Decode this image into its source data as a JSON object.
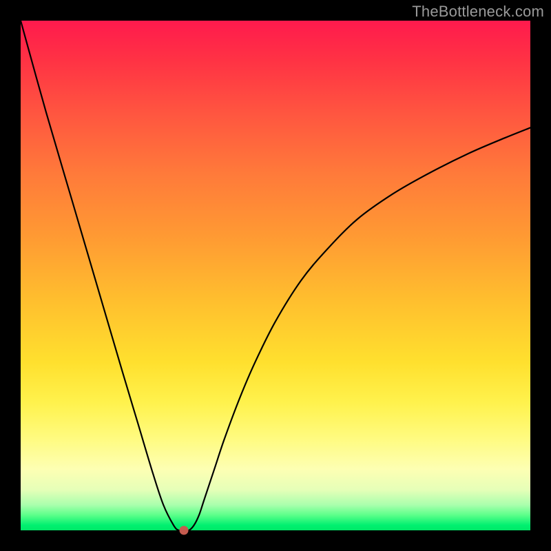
{
  "watermark": "TheBottleneck.com",
  "chart_data": {
    "type": "line",
    "title": "",
    "xlabel": "",
    "ylabel": "",
    "xlim": [
      0,
      100
    ],
    "ylim": [
      0,
      100
    ],
    "grid": false,
    "series": [
      {
        "name": "curve",
        "x": [
          0,
          5,
          10,
          15,
          20,
          23,
          26,
          28,
          30,
          31,
          32,
          33,
          34,
          35,
          36,
          38,
          40,
          43,
          46,
          50,
          55,
          60,
          66,
          73,
          80,
          88,
          95,
          100
        ],
        "y": [
          100,
          82,
          65,
          48,
          31,
          21,
          11,
          5,
          1,
          0,
          0,
          0,
          1,
          3,
          6,
          12,
          18,
          26,
          33,
          41,
          49,
          55,
          61,
          66,
          70,
          74,
          77,
          79
        ]
      }
    ],
    "marker": {
      "x": 32,
      "y": 0,
      "color": "#c55b4f"
    },
    "background_gradient": {
      "top": "#ff1a4d",
      "mid": "#ffe02e",
      "bottom": "#00e867"
    }
  }
}
